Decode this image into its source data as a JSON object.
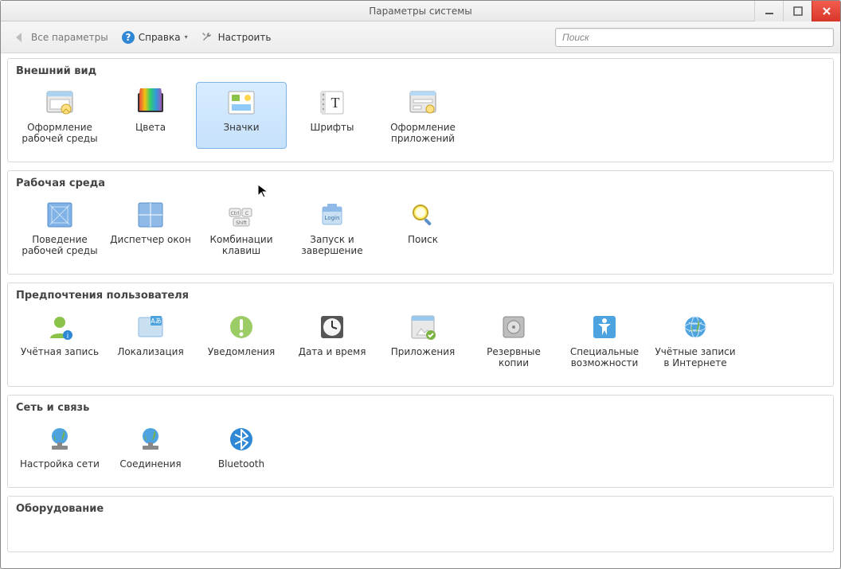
{
  "window": {
    "title": "Параметры системы"
  },
  "toolbar": {
    "all_params": "Все параметры",
    "help": "Справка",
    "configure": "Настроить"
  },
  "search": {
    "placeholder": "Поиск"
  },
  "groups": {
    "g0": {
      "title": "Внешний вид"
    },
    "g1": {
      "title": "Рабочая среда"
    },
    "g2": {
      "title": "Предпочтения пользователя"
    },
    "g3": {
      "title": "Сеть и связь"
    },
    "g4": {
      "title": "Оборудование"
    }
  },
  "items": {
    "appearance_theme": "Оформление\nрабочей среды",
    "colors": "Цвета",
    "icons": "Значки",
    "fonts": "Шрифты",
    "app_style": "Оформление\nприложений",
    "workspace_behavior": "Поведение\nрабочей среды",
    "wm": "Диспетчер окон",
    "shortcuts": "Комбинации\nклавиш",
    "startup": "Запуск и\nзавершение",
    "search": "Поиск",
    "account": "Учётная запись",
    "locale": "Локализация",
    "notifications": "Уведомления",
    "datetime": "Дата и время",
    "apps": "Приложения",
    "backup": "Резервные\nкопии",
    "accessibility": "Специальные\nвозможности",
    "online_accounts": "Учётные записи\nв Интернете",
    "network": "Настройка сети",
    "connections": "Соединения",
    "bluetooth": "Bluetooth"
  },
  "selected_item": "icons"
}
